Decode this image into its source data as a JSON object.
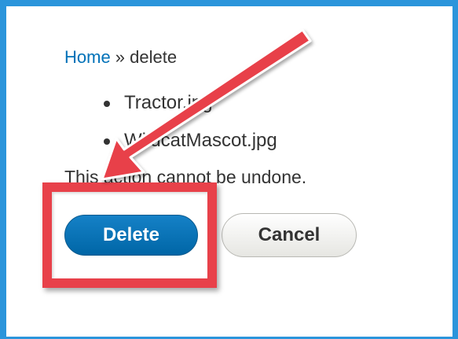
{
  "breadcrumb": {
    "home_label": "Home",
    "separator": " » ",
    "current": "delete"
  },
  "files": [
    {
      "name": "Tractor.jpg"
    },
    {
      "name": "WildcatMascot.jpg"
    }
  ],
  "warning_text": "This action cannot be undone.",
  "actions": {
    "delete_label": "Delete",
    "cancel_label": "Cancel"
  },
  "colors": {
    "frame_border": "#2b95db",
    "link": "#0071b8",
    "delete_button": "#0071b8",
    "annotation_red": "#e8414a"
  },
  "annotation": {
    "arrow_icon": "red-arrow-icon",
    "highlight": "red-highlight-box"
  }
}
